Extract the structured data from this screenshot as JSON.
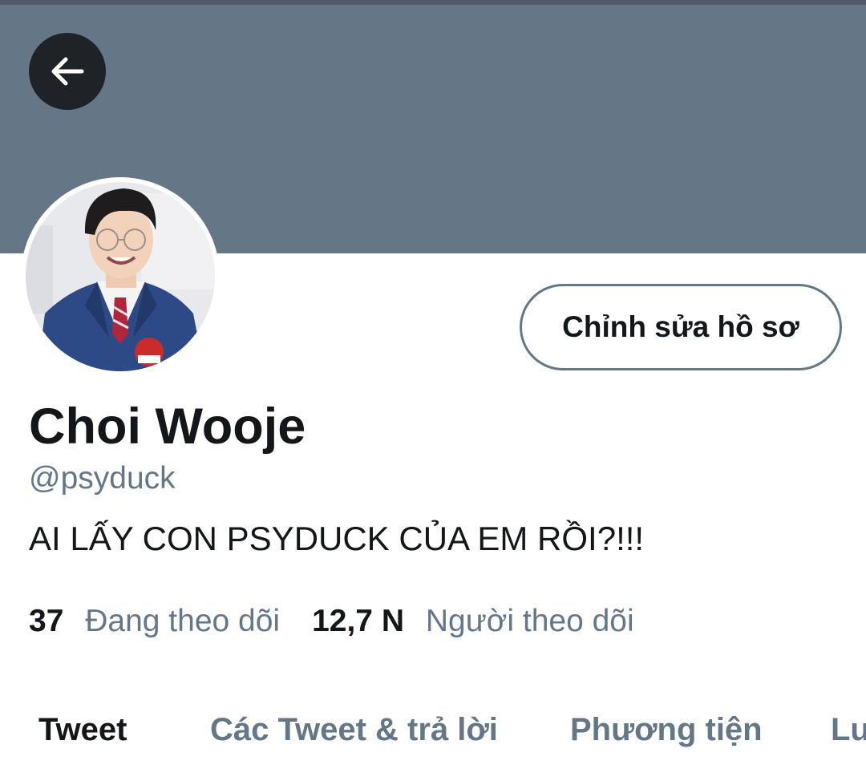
{
  "profile": {
    "display_name": "Choi Wooje",
    "handle": "@psyduck",
    "bio": "AI LẤY CON PSYDUCK CỦA EM RỒI?!!!",
    "edit_button_label": "Chỉnh sửa hồ sơ",
    "back_icon": "arrow-left-icon"
  },
  "stats": {
    "following_count": "37",
    "following_label": "Đang theo dõi",
    "followers_count": "12,7 N",
    "followers_label": "Người theo dõi"
  },
  "tabs": [
    {
      "label": "Tweet",
      "active": true
    },
    {
      "label": "Các Tweet & trả lời",
      "active": false
    },
    {
      "label": "Phương tiện",
      "active": false
    },
    {
      "label": "Lu",
      "active": false
    }
  ],
  "colors": {
    "banner": "#657786",
    "primary_text": "#14171a",
    "secondary_text": "#657786"
  }
}
